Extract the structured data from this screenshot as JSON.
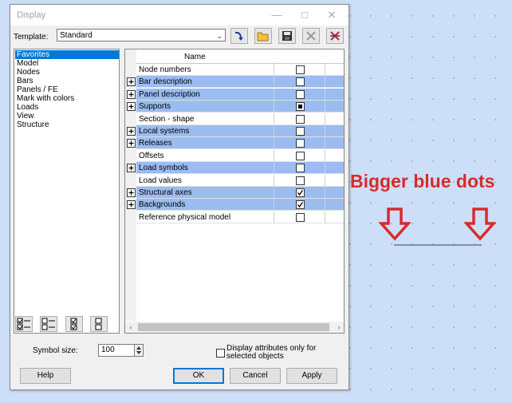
{
  "dialog": {
    "title": "Display",
    "template_label": "Template:",
    "template_value": "Standard",
    "symbol_size_label": "Symbol size:",
    "symbol_size_value": "100",
    "display_attr_label": "Display attributes only for selected objects",
    "buttons": {
      "help": "Help",
      "ok": "OK",
      "cancel": "Cancel",
      "apply": "Apply"
    }
  },
  "categories": [
    "Favorites",
    "Model",
    "Nodes",
    "Bars",
    "Panels / FE",
    "Mark with colors",
    "Loads",
    "View",
    "Structure"
  ],
  "selected_category": "Favorites",
  "grid": {
    "header": "Name",
    "rows": [
      {
        "name": "Node numbers",
        "expandable": false,
        "highlight": false,
        "checked": "off"
      },
      {
        "name": "Bar description",
        "expandable": true,
        "highlight": true,
        "checked": "off"
      },
      {
        "name": "Panel description",
        "expandable": true,
        "highlight": true,
        "checked": "off"
      },
      {
        "name": "Supports",
        "expandable": true,
        "highlight": true,
        "checked": "partial"
      },
      {
        "name": "Section - shape",
        "expandable": false,
        "highlight": false,
        "checked": "off"
      },
      {
        "name": "Local systems",
        "expandable": true,
        "highlight": true,
        "checked": "off"
      },
      {
        "name": "Releases",
        "expandable": true,
        "highlight": true,
        "checked": "off"
      },
      {
        "name": "Offsets",
        "expandable": false,
        "highlight": false,
        "checked": "off"
      },
      {
        "name": "Load symbols",
        "expandable": true,
        "highlight": true,
        "checked": "off"
      },
      {
        "name": "Load values",
        "expandable": false,
        "highlight": false,
        "checked": "off"
      },
      {
        "name": "Structural axes",
        "expandable": true,
        "highlight": true,
        "checked": "on"
      },
      {
        "name": "Backgrounds",
        "expandable": true,
        "highlight": true,
        "checked": "on"
      },
      {
        "name": "Reference physical model",
        "expandable": false,
        "highlight": false,
        "checked": "off"
      }
    ]
  },
  "annotation": {
    "text": "Bigger blue dots",
    "color": "#d92b2b"
  },
  "colors": {
    "highlight_row": "#9bbcf0",
    "selection": "#0078d7",
    "canvas": "#cddff8"
  }
}
